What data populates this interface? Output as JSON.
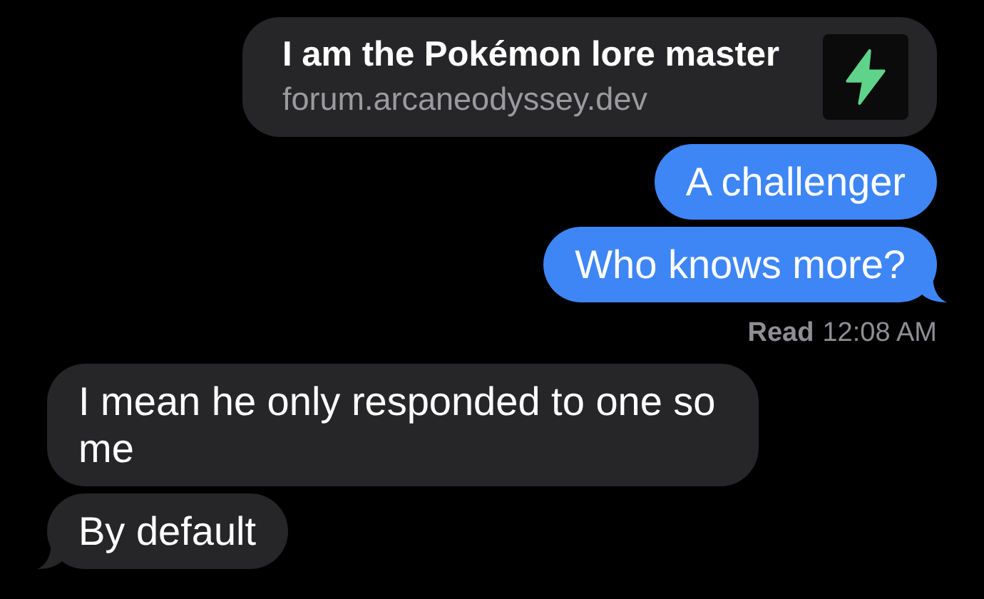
{
  "thread": [
    {
      "kind": "link",
      "title": "I am the Pokémon lore master",
      "url": "forum.arcaneodyssey.dev",
      "tail": false
    },
    {
      "kind": "outgoing",
      "text": "A challenger",
      "tail": false
    },
    {
      "kind": "outgoing",
      "text": "Who knows more?",
      "tail": true
    },
    {
      "kind": "receipt",
      "status": "Read",
      "time": "12:08 AM"
    },
    {
      "kind": "incoming",
      "text": "I mean he only responded to one so me",
      "tail": false
    },
    {
      "kind": "incoming",
      "text": "By default",
      "tail": true
    }
  ]
}
